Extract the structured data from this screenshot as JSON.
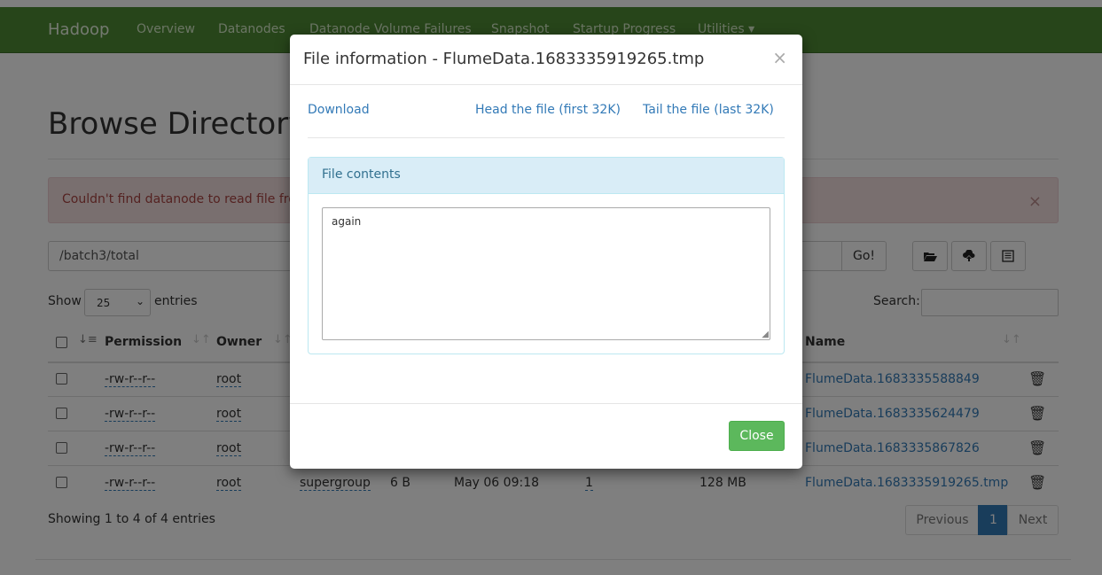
{
  "navbar": {
    "brand": "Hadoop",
    "items": [
      "Overview",
      "Datanodes",
      "Datanode Volume Failures",
      "Snapshot",
      "Startup Progress",
      "Utilities ▾"
    ]
  },
  "page": {
    "title": "Browse Directory",
    "alert_text": "Couldn't find datanode to read file from.",
    "path_value": "/batch3/total",
    "go_label": "Go!",
    "show_label": "Show",
    "entries_value": "25",
    "entries_label": "entries",
    "search_label": "Search:"
  },
  "table": {
    "headers": [
      "Permission",
      "Owner",
      "Name"
    ],
    "rows": [
      {
        "permission": "-rw-r--r--",
        "owner": "root",
        "name": "FlumeData.1683335588849"
      },
      {
        "permission": "-rw-r--r--",
        "owner": "root",
        "name": "FlumeData.1683335624479"
      },
      {
        "permission": "-rw-r--r--",
        "owner": "root",
        "name": "FlumeData.1683335867826"
      },
      {
        "permission": "-rw-r--r--",
        "owner": "root",
        "group": "supergroup",
        "size": "6 B",
        "modified": "May 06 09:18",
        "replication": "1",
        "blocksize": "128 MB",
        "name": "FlumeData.1683335919265.tmp"
      }
    ]
  },
  "footer": {
    "showing": "Showing 1 to 4 of 4 entries",
    "prev": "Previous",
    "page": "1",
    "next": "Next"
  },
  "modal": {
    "title": "File information - FlumeData.1683335919265.tmp",
    "download": "Download",
    "head": "Head the file (first 32K)",
    "tail": "Tail the file (last 32K)",
    "panel_title": "File contents",
    "content": "again",
    "close": "Close"
  },
  "colors": {
    "navbar": "#4e8a34",
    "primary": "#337ab7",
    "success": "#5cb85c",
    "danger_bg": "#f2dede",
    "info_bg": "#d9edf7"
  }
}
